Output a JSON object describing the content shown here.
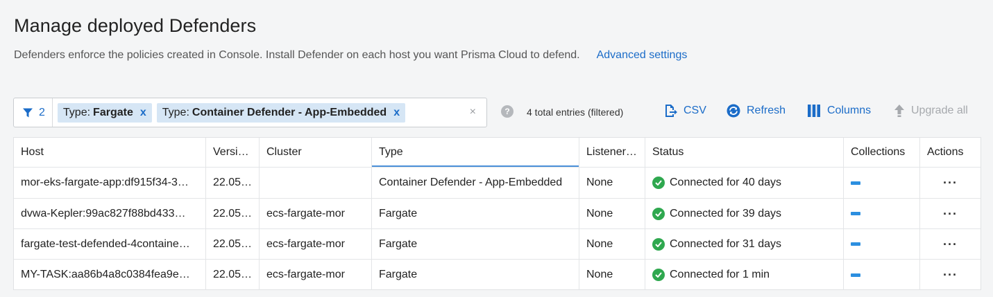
{
  "page": {
    "title": "Manage deployed Defenders",
    "description": "Defenders enforce the policies created in Console. Install Defender on each host you want Prisma Cloud to defend.",
    "advanced_settings_link": "Advanced settings"
  },
  "filter": {
    "count": "2",
    "chips": [
      {
        "key": "Type:",
        "value": "Fargate",
        "remove": "x"
      },
      {
        "key": "Type:",
        "value": "Container Defender - App-Embedded",
        "remove": "x"
      }
    ],
    "clear": "×"
  },
  "help_icon": "?",
  "entries_text": "4 total entries (filtered)",
  "toolbar": {
    "csv": "CSV",
    "refresh": "Refresh",
    "columns": "Columns",
    "upgrade_all": "Upgrade all"
  },
  "icons": {
    "filter": "funnel-icon",
    "csv": "file-export-icon",
    "refresh": "refresh-icon",
    "columns": "columns-icon",
    "upgrade": "up-arrow-icon",
    "status": "check-circle-icon"
  },
  "colors": {
    "accent": "#1b6cc8",
    "status_ok": "#2fa84f",
    "chip_bg": "#d6e6f5",
    "collection": "#2c8fe0"
  },
  "table": {
    "columns": [
      "Host",
      "Versi…",
      "Cluster",
      "Type",
      "Listener…",
      "Status",
      "Collections",
      "Actions"
    ],
    "rows": [
      {
        "host": "mor-eks-fargate-app:df915f34-3…",
        "version": "22.05…",
        "cluster": "",
        "type": "Container Defender - App-Embedded",
        "listener": "None",
        "status": "Connected for 40 days",
        "actions": "···"
      },
      {
        "host": "dvwa-Kepler:99ac827f88bd433…",
        "version": "22.05…",
        "cluster": "ecs-fargate-mor",
        "type": "Fargate",
        "listener": "None",
        "status": "Connected for 39 days",
        "actions": "···"
      },
      {
        "host": "fargate-test-defended-4containe…",
        "version": "22.05…",
        "cluster": "ecs-fargate-mor",
        "type": "Fargate",
        "listener": "None",
        "status": "Connected for 31 days",
        "actions": "···"
      },
      {
        "host": "MY-TASK:aa86b4a8c0384fea9e…",
        "version": "22.05…",
        "cluster": "ecs-fargate-mor",
        "type": "Fargate",
        "listener": "None",
        "status": "Connected for 1 min",
        "actions": "···"
      }
    ]
  }
}
